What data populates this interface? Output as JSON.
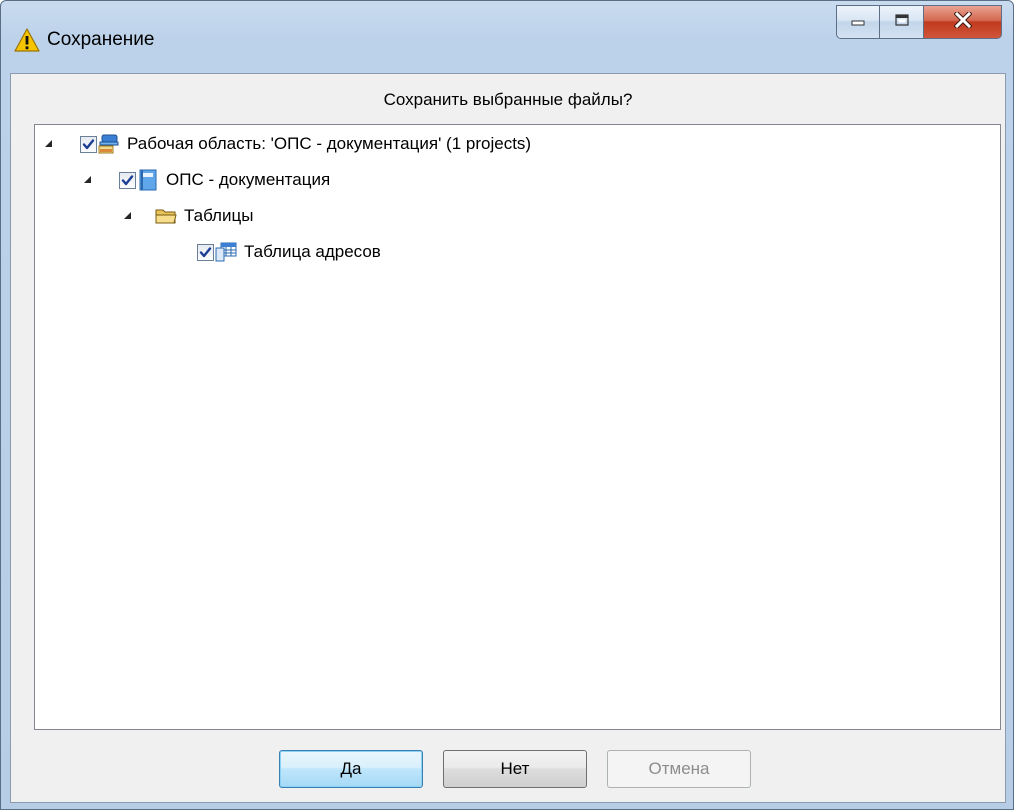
{
  "window": {
    "title": "Сохранение",
    "title_icon": "warning-icon",
    "caption_buttons": [
      "minimize-icon",
      "maximize-icon",
      "close-icon"
    ]
  },
  "dialog": {
    "prompt": "Сохранить выбранные файлы?"
  },
  "tree": {
    "nodes": [
      {
        "label": "Рабочая область: 'ОПС - документация' (1 projects)",
        "level": 0,
        "expanded": true,
        "checked": true,
        "icon": "workspace-icon"
      },
      {
        "label": "ОПС - документация",
        "level": 1,
        "expanded": true,
        "checked": true,
        "icon": "project-icon"
      },
      {
        "label": "Таблицы",
        "level": 2,
        "expanded": true,
        "checked": null,
        "icon": "folder-icon"
      },
      {
        "label": "Таблица адресов",
        "level": 3,
        "expanded": null,
        "checked": true,
        "icon": "table-icon"
      }
    ]
  },
  "buttons": {
    "yes": "Да",
    "no": "Нет",
    "cancel": "Отмена",
    "cancel_disabled": true
  },
  "colors": {
    "title_gradient": "#c9dbef",
    "client_bg": "#f0f0f0",
    "close_button": "#c03a1e",
    "default_button_border": "#3c7fb1",
    "checkmark": "#1c3f95"
  }
}
